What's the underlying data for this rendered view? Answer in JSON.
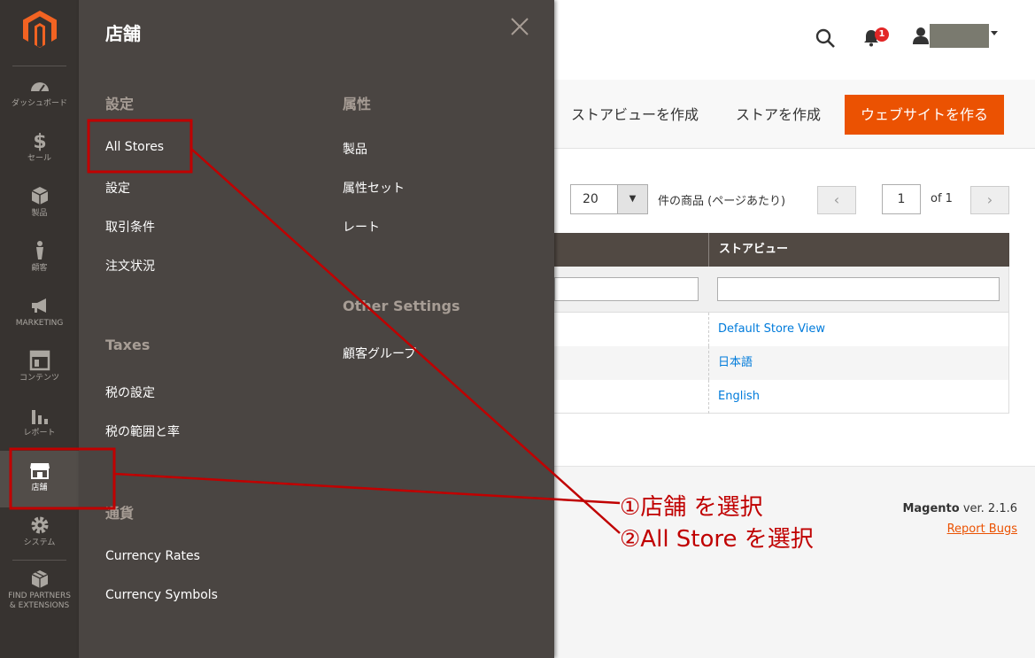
{
  "sidebar": {
    "items": [
      {
        "label": "ダッシュボード",
        "icon": "dashboard-icon"
      },
      {
        "label": "セール",
        "icon": "dollar-icon"
      },
      {
        "label": "製品",
        "icon": "box-icon"
      },
      {
        "label": "顧客",
        "icon": "person-icon"
      },
      {
        "label": "MARKETING",
        "icon": "megaphone-icon"
      },
      {
        "label": "コンテンツ",
        "icon": "layout-icon"
      },
      {
        "label": "レポート",
        "icon": "bar-chart-icon"
      },
      {
        "label": "店舗",
        "icon": "storefront-icon"
      },
      {
        "label": "システム",
        "icon": "gear-icon"
      },
      {
        "label_line1": "FIND PARTNERS",
        "label_line2": "& EXTENSIONS",
        "icon": "cubes-icon"
      }
    ],
    "active_index": 7
  },
  "panel": {
    "title": "店舗",
    "sections": {
      "settings": {
        "heading": "設定",
        "links": [
          "All Stores",
          "設定",
          "取引条件",
          "注文状況"
        ]
      },
      "taxes": {
        "heading": "Taxes",
        "links": [
          "税の設定",
          "税の範囲と率"
        ]
      },
      "currency": {
        "heading": "通貨",
        "links": [
          "Currency Rates",
          "Currency Symbols"
        ]
      },
      "attributes": {
        "heading": "属性",
        "links": [
          "製品",
          "属性セット",
          "レート"
        ]
      },
      "other": {
        "heading": "Other Settings",
        "links": [
          "顧客グループ"
        ]
      }
    }
  },
  "header": {
    "notification_count": "1"
  },
  "actions": {
    "create_store_view": "ストアビューを作成",
    "create_store": "ストアを作成",
    "create_website": "ウェブサイトを作る"
  },
  "grid": {
    "per_page": "20",
    "per_page_text": "件の商品 (ページあたり)",
    "page": "1",
    "of_text": "of 1",
    "column_store_view": "ストアビュー",
    "rows": [
      "Default Store View",
      "日本語",
      "English"
    ]
  },
  "footer": {
    "brand": "Magento",
    "version": "ver. 2.1.6",
    "report_bugs": "Report Bugs"
  },
  "annotation": {
    "step1": "①店舗 を選択",
    "step2": "②All Store を選択",
    "color": "#c00000"
  },
  "colors": {
    "sidebar_bg": "#373330",
    "panel_bg": "#4a4542",
    "accent": "#eb5202",
    "link": "#007bdb"
  }
}
